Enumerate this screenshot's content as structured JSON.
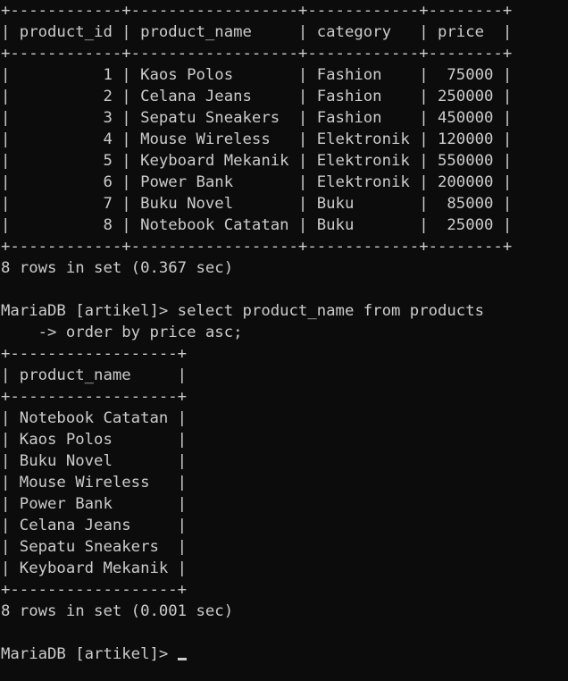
{
  "lines": [
    "+------------+------------------+------------+--------+",
    "| product_id | product_name     | category   | price  |",
    "+------------+------------------+------------+--------+",
    "|          1 | Kaos Polos       | Fashion    |  75000 |",
    "|          2 | Celana Jeans     | Fashion    | 250000 |",
    "|          3 | Sepatu Sneakers  | Fashion    | 450000 |",
    "|          4 | Mouse Wireless   | Elektronik | 120000 |",
    "|          5 | Keyboard Mekanik | Elektronik | 550000 |",
    "|          6 | Power Bank       | Elektronik | 200000 |",
    "|          7 | Buku Novel       | Buku       |  85000 |",
    "|          8 | Notebook Catatan | Buku       |  25000 |",
    "+------------+------------------+------------+--------+",
    "8 rows in set (0.367 sec)",
    "",
    "MariaDB [artikel]> select product_name from products",
    "    -> order by price asc;",
    "+------------------+",
    "| product_name     |",
    "+------------------+",
    "| Notebook Catatan |",
    "| Kaos Polos       |",
    "| Buku Novel       |",
    "| Mouse Wireless   |",
    "| Power Bank       |",
    "| Celana Jeans     |",
    "| Sepatu Sneakers  |",
    "| Keyboard Mekanik |",
    "+------------------+",
    "8 rows in set (0.001 sec)",
    "",
    "MariaDB [artikel]> "
  ],
  "colors": {
    "background": "#0c0c0c",
    "text": "#cccccc"
  }
}
